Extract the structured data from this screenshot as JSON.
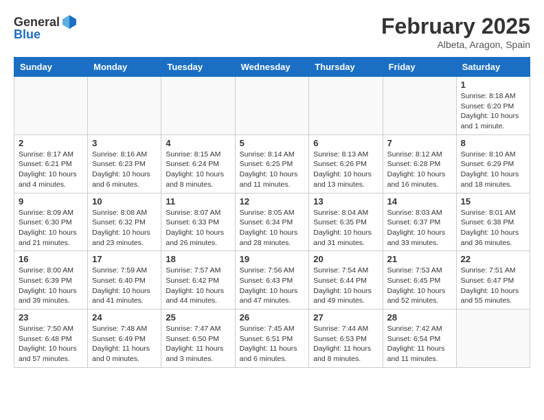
{
  "header": {
    "logo_general": "General",
    "logo_blue": "Blue",
    "month": "February 2025",
    "location": "Albeta, Aragon, Spain"
  },
  "weekdays": [
    "Sunday",
    "Monday",
    "Tuesday",
    "Wednesday",
    "Thursday",
    "Friday",
    "Saturday"
  ],
  "weeks": [
    [
      {
        "day": "",
        "info": ""
      },
      {
        "day": "",
        "info": ""
      },
      {
        "day": "",
        "info": ""
      },
      {
        "day": "",
        "info": ""
      },
      {
        "day": "",
        "info": ""
      },
      {
        "day": "",
        "info": ""
      },
      {
        "day": "1",
        "info": "Sunrise: 8:18 AM\nSunset: 6:20 PM\nDaylight: 10 hours\nand 1 minute."
      }
    ],
    [
      {
        "day": "2",
        "info": "Sunrise: 8:17 AM\nSunset: 6:21 PM\nDaylight: 10 hours\nand 4 minutes."
      },
      {
        "day": "3",
        "info": "Sunrise: 8:16 AM\nSunset: 6:23 PM\nDaylight: 10 hours\nand 6 minutes."
      },
      {
        "day": "4",
        "info": "Sunrise: 8:15 AM\nSunset: 6:24 PM\nDaylight: 10 hours\nand 8 minutes."
      },
      {
        "day": "5",
        "info": "Sunrise: 8:14 AM\nSunset: 6:25 PM\nDaylight: 10 hours\nand 11 minutes."
      },
      {
        "day": "6",
        "info": "Sunrise: 8:13 AM\nSunset: 6:26 PM\nDaylight: 10 hours\nand 13 minutes."
      },
      {
        "day": "7",
        "info": "Sunrise: 8:12 AM\nSunset: 6:28 PM\nDaylight: 10 hours\nand 16 minutes."
      },
      {
        "day": "8",
        "info": "Sunrise: 8:10 AM\nSunset: 6:29 PM\nDaylight: 10 hours\nand 18 minutes."
      }
    ],
    [
      {
        "day": "9",
        "info": "Sunrise: 8:09 AM\nSunset: 6:30 PM\nDaylight: 10 hours\nand 21 minutes."
      },
      {
        "day": "10",
        "info": "Sunrise: 8:08 AM\nSunset: 6:32 PM\nDaylight: 10 hours\nand 23 minutes."
      },
      {
        "day": "11",
        "info": "Sunrise: 8:07 AM\nSunset: 6:33 PM\nDaylight: 10 hours\nand 26 minutes."
      },
      {
        "day": "12",
        "info": "Sunrise: 8:05 AM\nSunset: 6:34 PM\nDaylight: 10 hours\nand 28 minutes."
      },
      {
        "day": "13",
        "info": "Sunrise: 8:04 AM\nSunset: 6:35 PM\nDaylight: 10 hours\nand 31 minutes."
      },
      {
        "day": "14",
        "info": "Sunrise: 8:03 AM\nSunset: 6:37 PM\nDaylight: 10 hours\nand 33 minutes."
      },
      {
        "day": "15",
        "info": "Sunrise: 8:01 AM\nSunset: 6:38 PM\nDaylight: 10 hours\nand 36 minutes."
      }
    ],
    [
      {
        "day": "16",
        "info": "Sunrise: 8:00 AM\nSunset: 6:39 PM\nDaylight: 10 hours\nand 39 minutes."
      },
      {
        "day": "17",
        "info": "Sunrise: 7:59 AM\nSunset: 6:40 PM\nDaylight: 10 hours\nand 41 minutes."
      },
      {
        "day": "18",
        "info": "Sunrise: 7:57 AM\nSunset: 6:42 PM\nDaylight: 10 hours\nand 44 minutes."
      },
      {
        "day": "19",
        "info": "Sunrise: 7:56 AM\nSunset: 6:43 PM\nDaylight: 10 hours\nand 47 minutes."
      },
      {
        "day": "20",
        "info": "Sunrise: 7:54 AM\nSunset: 6:44 PM\nDaylight: 10 hours\nand 49 minutes."
      },
      {
        "day": "21",
        "info": "Sunrise: 7:53 AM\nSunset: 6:45 PM\nDaylight: 10 hours\nand 52 minutes."
      },
      {
        "day": "22",
        "info": "Sunrise: 7:51 AM\nSunset: 6:47 PM\nDaylight: 10 hours\nand 55 minutes."
      }
    ],
    [
      {
        "day": "23",
        "info": "Sunrise: 7:50 AM\nSunset: 6:48 PM\nDaylight: 10 hours\nand 57 minutes."
      },
      {
        "day": "24",
        "info": "Sunrise: 7:48 AM\nSunset: 6:49 PM\nDaylight: 11 hours\nand 0 minutes."
      },
      {
        "day": "25",
        "info": "Sunrise: 7:47 AM\nSunset: 6:50 PM\nDaylight: 11 hours\nand 3 minutes."
      },
      {
        "day": "26",
        "info": "Sunrise: 7:45 AM\nSunset: 6:51 PM\nDaylight: 11 hours\nand 6 minutes."
      },
      {
        "day": "27",
        "info": "Sunrise: 7:44 AM\nSunset: 6:53 PM\nDaylight: 11 hours\nand 8 minutes."
      },
      {
        "day": "28",
        "info": "Sunrise: 7:42 AM\nSunset: 6:54 PM\nDaylight: 11 hours\nand 11 minutes."
      },
      {
        "day": "",
        "info": ""
      }
    ]
  ]
}
